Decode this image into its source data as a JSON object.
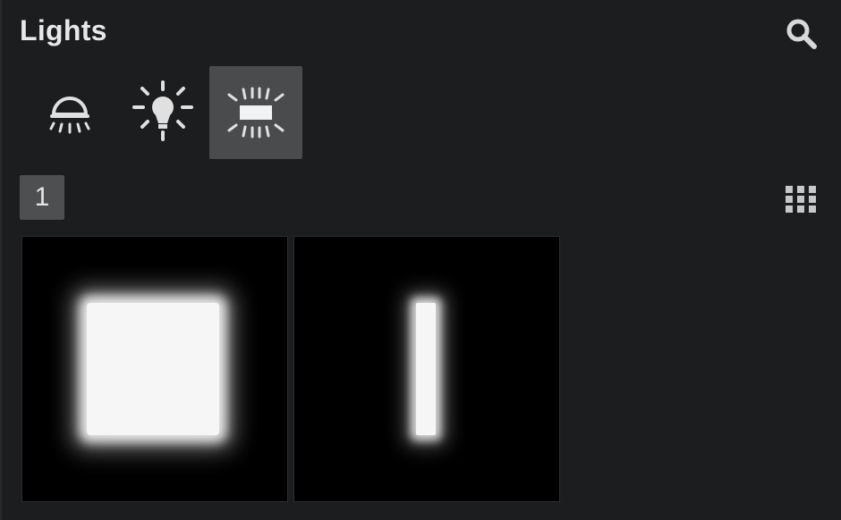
{
  "panel": {
    "title": "Lights"
  },
  "toolbar": {
    "search_icon": "search-icon",
    "grid_icon": "grid-view-icon"
  },
  "light_types": [
    {
      "name": "spot-light",
      "icon": "spot-light-icon",
      "active": false
    },
    {
      "name": "point-light",
      "icon": "point-light-icon",
      "active": false
    },
    {
      "name": "area-light",
      "icon": "area-light-icon",
      "active": true
    }
  ],
  "pagination": {
    "current_page": "1"
  },
  "presets": [
    {
      "shape": "square"
    },
    {
      "shape": "vertical-bar"
    }
  ],
  "colors": {
    "background": "#1c1d1f",
    "active_tab": "#4a4b4d",
    "text": "#e8e8e8",
    "icon": "#e0e0e0",
    "thumb_bg": "#000000",
    "light_shape": "#f6f6f6"
  }
}
